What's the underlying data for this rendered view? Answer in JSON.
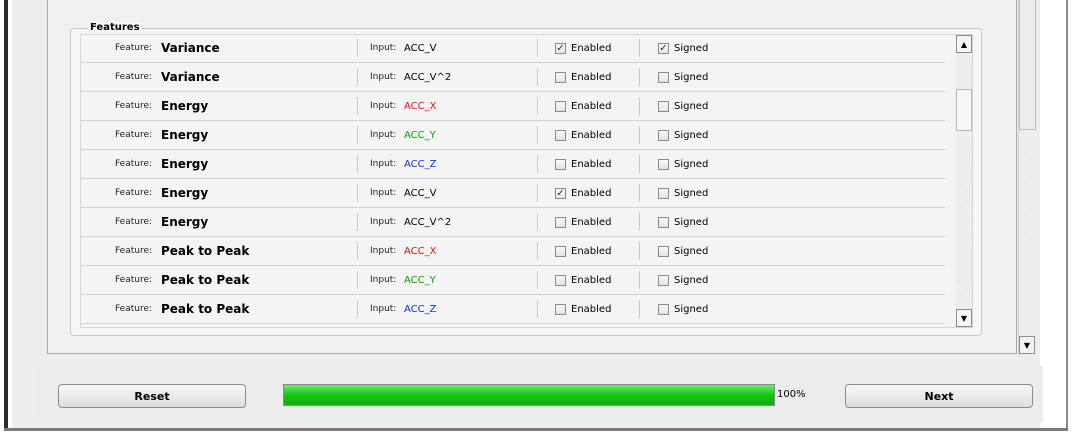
{
  "features": {
    "group_label": "Features",
    "feature_prefix": "Feature:",
    "input_prefix": "Input:",
    "enabled_label": "Enabled",
    "signed_label": "Signed",
    "rows": [
      {
        "name": "Variance",
        "input": "ACC_V",
        "input_color": "#000000",
        "enabled": true,
        "signed": true
      },
      {
        "name": "Variance",
        "input": "ACC_V^2",
        "input_color": "#000000",
        "enabled": false,
        "signed": false
      },
      {
        "name": "Energy",
        "input": "ACC_X",
        "input_color": "#e01010",
        "enabled": false,
        "signed": false
      },
      {
        "name": "Energy",
        "input": "ACC_Y",
        "input_color": "#0a9a0a",
        "enabled": false,
        "signed": false
      },
      {
        "name": "Energy",
        "input": "ACC_Z",
        "input_color": "#1030e0",
        "enabled": false,
        "signed": false
      },
      {
        "name": "Energy",
        "input": "ACC_V",
        "input_color": "#000000",
        "enabled": true,
        "signed": false
      },
      {
        "name": "Energy",
        "input": "ACC_V^2",
        "input_color": "#000000",
        "enabled": false,
        "signed": false
      },
      {
        "name": "Peak to Peak",
        "input": "ACC_X",
        "input_color": "#e01010",
        "enabled": false,
        "signed": false
      },
      {
        "name": "Peak to Peak",
        "input": "ACC_Y",
        "input_color": "#0a9a0a",
        "enabled": false,
        "signed": false
      },
      {
        "name": "Peak to Peak",
        "input": "ACC_Z",
        "input_color": "#1030e0",
        "enabled": false,
        "signed": false
      }
    ]
  },
  "footer": {
    "reset_label": "Reset",
    "next_label": "Next",
    "progress_text": "100%",
    "progress_value": 100,
    "progress_color": "#14c414"
  },
  "icons": {
    "scroll_up": "scroll-up-arrow-icon",
    "scroll_down": "scroll-down-arrow-icon",
    "check": "checkmark-icon"
  }
}
